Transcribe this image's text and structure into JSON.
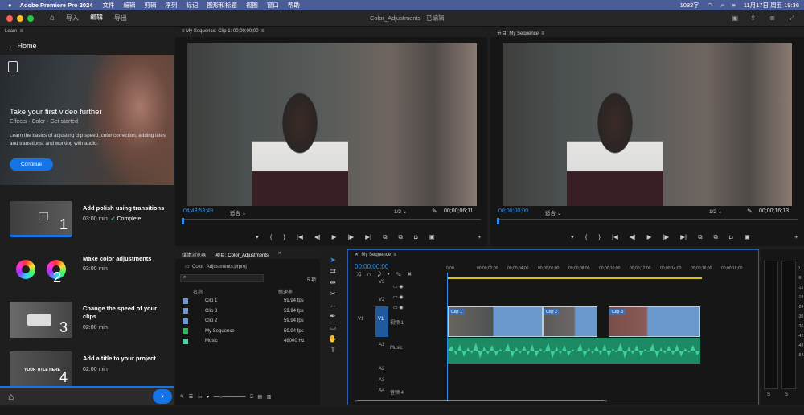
{
  "menubar": {
    "app": "Adobe Premiere Pro 2024",
    "items": [
      "文件",
      "编辑",
      "剪辑",
      "序列",
      "标记",
      "图形和标题",
      "视图",
      "窗口",
      "帮助"
    ],
    "datetime": "11月17日 周五  19:36",
    "badge": "1082字"
  },
  "titlebar": {
    "tabs": [
      "导入",
      "编辑",
      "导出"
    ],
    "title": "Color_Adjustments - 已编辑"
  },
  "learn": {
    "panel": "Learn",
    "back": "Home",
    "hero_title": "Take your first video further",
    "hero_sub": "Effects  ·  Color  ·  Get started",
    "hero_desc": "Learn the basics of adjusting clip speed, color correction, adding titles and transitions, and working with audio.",
    "continue": "Continue",
    "lessons": [
      {
        "title": "Add polish using transitions",
        "time": "03:00 min",
        "status": "Complete",
        "num": "1"
      },
      {
        "title": "Make color adjustments",
        "time": "03:00 min",
        "num": "2"
      },
      {
        "title": "Change the speed of your clips",
        "time": "02:00 min",
        "num": "3"
      },
      {
        "title": "Add a title to your project",
        "time": "02:00 min",
        "num": "4",
        "thumb": "YOUR TITLE HERE"
      }
    ]
  },
  "source": {
    "tab": "My Sequence: Clip 1: 00;00;00;00",
    "tc_left": "04;43;53;49",
    "fit": "适合",
    "ratio": "1/2",
    "tc_right": "00;00;06;11"
  },
  "program": {
    "tab": "节目: My Sequence",
    "tc_left": "00;00;00;00",
    "fit": "适合",
    "ratio": "1/2",
    "tc_right": "00;00;16;13"
  },
  "project": {
    "tabs": [
      "媒体浏览器",
      "项目: Color_Adjustments"
    ],
    "file": "Color_Adjustments.prproj",
    "count": "5 项",
    "col_name": "名称",
    "col_rate": "帧速率",
    "items": [
      {
        "name": "Clip 1",
        "rate": "59.94 fps",
        "color": "#6b97d4"
      },
      {
        "name": "Clip 3",
        "rate": "59.94 fps",
        "color": "#6b97d4"
      },
      {
        "name": "Clip 2",
        "rate": "59.94 fps",
        "color": "#6b97d4"
      },
      {
        "name": "My Sequence",
        "rate": "59.94 fps",
        "color": "#3bb36a"
      },
      {
        "name": "Music",
        "rate": "48000 Hz",
        "color": "#4ad3a3"
      }
    ]
  },
  "timeline": {
    "tab": "My Sequence",
    "tc": "00;00;00;00",
    "ruler": [
      "0;00",
      "00;00;02;00",
      "00;00;04;00",
      "00;00;06;00",
      "00;00;08;00",
      "00;00;10;00",
      "00;00;12;00",
      "00;00;14;00",
      "00;00;16;00",
      "00;00;18;00"
    ],
    "tracks": [
      "V3",
      "V2",
      "V1",
      "A1",
      "A2",
      "A3",
      "A4"
    ],
    "v1_name": "视频 1",
    "a2_name": "Music",
    "a4_name": "音频 4",
    "clips": [
      "Clip 1",
      "Clip 2",
      "Clip 3"
    ]
  },
  "colors": {
    "accent": "#1473e6",
    "menubar": "#4a5c95",
    "audio": "#1c8a63",
    "video_clip": "#6a9acd"
  }
}
